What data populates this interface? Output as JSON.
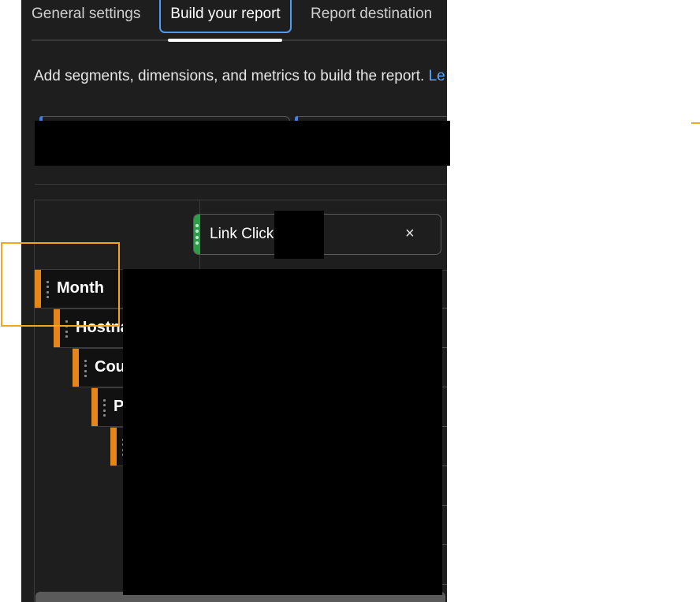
{
  "tabs": [
    {
      "label": "General settings"
    },
    {
      "label": "Build your report",
      "active": true
    },
    {
      "label": "Report destination"
    }
  ],
  "intro": {
    "text": "Add segments, dimensions, and metrics to build the report.",
    "link": "Le"
  },
  "metric": {
    "label": "Link Click",
    "remove_label": "×",
    "color": "#2d9d4a"
  },
  "dimensions": [
    {
      "label": "Month"
    },
    {
      "label": "Hostna"
    },
    {
      "label": "Cou"
    },
    {
      "label": "P"
    },
    {
      "label": ""
    }
  ],
  "colors": {
    "accent_tab": "#4b9cf5",
    "dimension": "#e68619",
    "highlight": "#f2a71e",
    "panel_bg": "#1e1e1e"
  }
}
